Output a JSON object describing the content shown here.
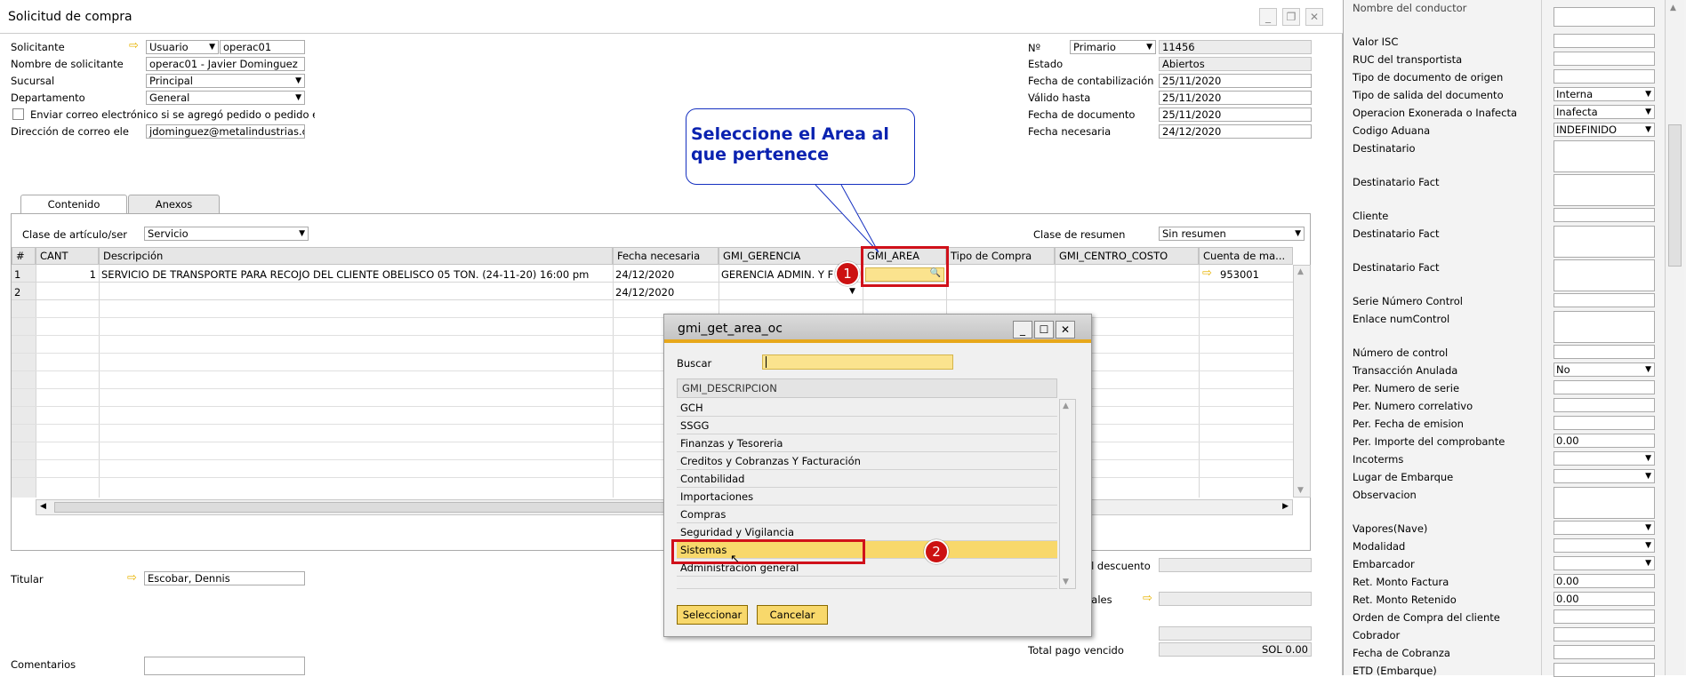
{
  "window": {
    "title": "Solicitud de compra"
  },
  "header": {
    "solicitante_label": "Solicitante",
    "solicitante_type": "Usuario",
    "solicitante_value": "operac01",
    "nombre_label": "Nombre de solicitante",
    "nombre_value": "operac01 - Javier Dominguez",
    "sucursal_label": "Sucursal",
    "sucursal_value": "Principal",
    "departamento_label": "Departamento",
    "departamento_value": "General",
    "enviar_label": "Enviar correo electrónico si se agregó pedido o pedido e",
    "correo_label": "Dirección de correo ele",
    "correo_value": "jdominguez@metalindustrias.co",
    "no_label": "Nº",
    "no_series": "Primario",
    "no_value": "11456",
    "estado_label": "Estado",
    "estado_value": "Abiertos",
    "fcont_label": "Fecha de contabilización",
    "fcont_value": "25/11/2020",
    "valido_label": "Válido hasta",
    "valido_value": "25/11/2020",
    "fdoc_label": "Fecha de documento",
    "fdoc_value": "25/11/2020",
    "fnec_label": "Fecha necesaria",
    "fnec_value": "24/12/2020"
  },
  "tabs": {
    "contenido": "Contenido",
    "anexos": "Anexos"
  },
  "content": {
    "clase_label": "Clase de artículo/ser",
    "clase_value": "Servicio",
    "resumen_label": "Clase de resumen",
    "resumen_value": "Sin resumen"
  },
  "grid": {
    "headers": [
      "#",
      "CANT",
      "Descripción",
      "Fecha necesaria",
      "GMI_GERENCIA",
      "GMI_AREA",
      "Tipo de Compra",
      "GMI_CENTRO_COSTO",
      "Cuenta de ma..."
    ],
    "rows": [
      {
        "num": "1",
        "cant": "1",
        "desc": "SERVICIO DE TRANSPORTE PARA RECOJO DEL CLIENTE OBELISCO 05 TON. (24-11-20) 16:00 pm",
        "fecha": "24/12/2020",
        "gerencia": "GERENCIA ADMIN. Y F",
        "cuenta": "953001"
      },
      {
        "num": "2",
        "cant": "",
        "desc": "",
        "fecha": "24/12/2020",
        "gerencia": "",
        "cuenta": ""
      }
    ]
  },
  "callout": {
    "text": "Seleccione el Area al que pertenece"
  },
  "badges": {
    "one": "1",
    "two": "2"
  },
  "popup": {
    "title": "gmi_get_area_oc",
    "buscar_label": "Buscar",
    "column": "GMI_DESCRIPCION",
    "items": [
      "GCH",
      "SSGG",
      "Finanzas y Tesoreria",
      "Creditos y Cobranzas Y Facturación",
      "Contabilidad",
      "Importaciones",
      "Compras",
      "Seguridad y Vigilancia",
      "Sistemas",
      "Administración general"
    ],
    "select_btn": "Seleccionar",
    "cancel_btn": "Cancelar"
  },
  "footer": {
    "titular_label": "Titular",
    "titular_value": "Escobar, Dennis",
    "comentarios_label": "Comentarios",
    "descuento_label": "el descuento",
    "nales_label": "nales",
    "total_label": "Total pago vencido",
    "total_value": "SOL 0.00"
  },
  "right_panel": {
    "top_label": "Nombre del conductor",
    "fields": [
      {
        "label": "Valor ISC",
        "value": ""
      },
      {
        "label": "RUC del transportista",
        "value": ""
      },
      {
        "label": "Tipo de documento de origen",
        "value": ""
      },
      {
        "label": "Tipo de salida del documento",
        "value": "Interna"
      },
      {
        "label": "Operacion Exonerada o Inafecta",
        "value": "Inafecta"
      },
      {
        "label": "Codigo Aduana",
        "value": "INDEFINIDO"
      },
      {
        "label": "Destinatario",
        "value": ""
      },
      {
        "label": "Destinatario Fact",
        "value": ""
      },
      {
        "label": "Cliente",
        "value": ""
      },
      {
        "label": "Destinatario Fact",
        "value": ""
      },
      {
        "label": "Destinatario Fact",
        "value": ""
      },
      {
        "label": "Serie Número Control",
        "value": ""
      },
      {
        "label": "Enlace numControl",
        "value": ""
      },
      {
        "label": "Número de control",
        "value": ""
      },
      {
        "label": "Transacción Anulada",
        "value": "No"
      },
      {
        "label": "Per. Numero de serie",
        "value": ""
      },
      {
        "label": "Per. Numero correlativo",
        "value": ""
      },
      {
        "label": "Per. Fecha de emision",
        "value": ""
      },
      {
        "label": "Per. Importe del comprobante",
        "value": "0.00"
      },
      {
        "label": "Incoterms",
        "value": ""
      },
      {
        "label": "Lugar de Embarque",
        "value": ""
      },
      {
        "label": "Observacion",
        "value": ""
      },
      {
        "label": "Vapores(Nave)",
        "value": ""
      },
      {
        "label": "Modalidad",
        "value": ""
      },
      {
        "label": "Embarcador",
        "value": ""
      },
      {
        "label": "Ret. Monto Factura",
        "value": "0.00"
      },
      {
        "label": "Ret. Monto Retenido",
        "value": "0.00"
      },
      {
        "label": "Orden de Compra del cliente",
        "value": ""
      },
      {
        "label": "Cobrador",
        "value": ""
      },
      {
        "label": "Fecha de Cobranza",
        "value": ""
      },
      {
        "label": "ETD (Embarque)",
        "value": ""
      }
    ]
  }
}
